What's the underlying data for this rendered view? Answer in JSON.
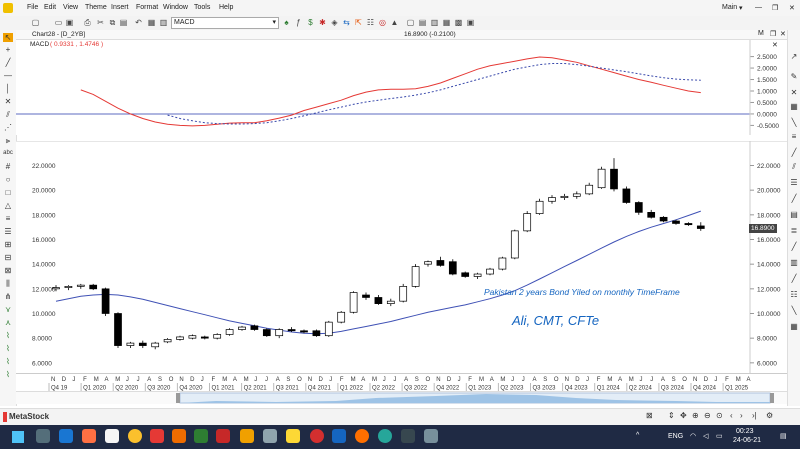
{
  "menubar": {
    "app_icon": "metastock-icon",
    "items": [
      "File",
      "Edit",
      "View",
      "Theme",
      "Insert",
      "Format",
      "Window",
      "Tools",
      "Help"
    ],
    "workspace": "Main",
    "window_controls": [
      "minimize",
      "restore",
      "close"
    ]
  },
  "toolbar": {
    "indicator_selector": "MACD"
  },
  "chart": {
    "tab": "Chart28 - [D_2YB]",
    "last_value": "16.8900 (-0.2100)",
    "price_badge": "16.8900",
    "macd_label": "MACD",
    "macd_values": "( 0.9331 ,  1.4746 )",
    "annotation_title": "Pakistan 2 years Bond Yiled on monthly TimeFrame",
    "annotation_author": "Ali, CMT, CFTe",
    "colors": {
      "macd_line": "#e53935",
      "signal_line": "#3949ab",
      "zero_line": "#5c6bc0",
      "ma_line": "#3f51b5",
      "annotation": "#1565c0"
    }
  },
  "chart_data": [
    {
      "type": "line",
      "title": "MACD",
      "y_ticks": [
        "2.5000",
        "2.0000",
        "1.5000",
        "1.0000",
        "0.5000",
        "0.0000",
        "-0.5000"
      ],
      "ylim": [
        -0.7,
        2.7
      ],
      "x_index": [
        0,
        1,
        2,
        3,
        4,
        5,
        6,
        7,
        8,
        9,
        10,
        11,
        12,
        13,
        14,
        15,
        16,
        17,
        18,
        19,
        20,
        21,
        22,
        23,
        24,
        25,
        26,
        27,
        28,
        29,
        30,
        31,
        32,
        33,
        34,
        35,
        36,
        37,
        38,
        39,
        40,
        41,
        42,
        43,
        44,
        45,
        46,
        47,
        48,
        49,
        50,
        51,
        52
      ],
      "series": [
        {
          "values": [
            null,
            null,
            1.05,
            0.85,
            0.55,
            0.25,
            0.0,
            -0.2,
            -0.35,
            -0.45,
            -0.5,
            -0.52,
            -0.5,
            -0.45,
            -0.4,
            -0.38,
            -0.38,
            -0.3,
            -0.18,
            -0.05,
            0.15,
            0.3,
            0.45,
            0.6,
            0.8,
            0.95,
            1.05,
            1.08,
            1.08,
            1.1,
            1.2,
            1.35,
            1.55,
            1.75,
            1.95,
            2.1,
            2.2,
            2.3,
            2.4,
            2.48,
            2.45,
            2.35,
            2.25,
            2.1,
            1.95,
            1.8,
            1.65,
            1.5,
            1.38,
            1.25,
            1.12,
            1.0,
            0.93
          ]
        },
        {
          "values": [
            null,
            null,
            null,
            null,
            null,
            null,
            null,
            null,
            null,
            -0.05,
            -0.2,
            -0.3,
            -0.38,
            -0.42,
            -0.44,
            -0.44,
            -0.42,
            -0.38,
            -0.3,
            -0.2,
            -0.08,
            0.05,
            0.18,
            0.3,
            0.42,
            0.52,
            0.6,
            0.67,
            0.74,
            0.82,
            0.92,
            1.05,
            1.2,
            1.35,
            1.5,
            1.65,
            1.8,
            1.95,
            2.05,
            2.15,
            2.2,
            2.2,
            2.15,
            2.08,
            2.0,
            1.92,
            1.84,
            1.75,
            1.66,
            1.58,
            1.52,
            1.49,
            1.47
          ]
        }
      ]
    },
    {
      "type": "candlestick",
      "y_ticks": [
        "22.0000",
        "20.0000",
        "18.0000",
        "16.0000",
        "14.0000",
        "12.0000",
        "10.0000",
        "8.0000",
        "6.0000"
      ],
      "ylim": [
        5.5,
        23.5
      ],
      "month_labels": [
        "N",
        "D",
        "J",
        "F",
        "M",
        "A",
        "M",
        "J",
        "J",
        "A",
        "S",
        "O",
        "N",
        "D",
        "J",
        "F",
        "M",
        "A",
        "M",
        "J",
        "J",
        "A",
        "S",
        "O",
        "N",
        "D",
        "J",
        "F",
        "M",
        "A",
        "M",
        "J",
        "J",
        "A",
        "S",
        "O",
        "N",
        "D",
        "J",
        "F",
        "M",
        "A",
        "M",
        "J",
        "J",
        "A",
        "S",
        "O",
        "N",
        "D",
        "J",
        "F",
        "M",
        "A",
        "M",
        "J",
        "J",
        "A",
        "S",
        "O",
        "N",
        "D",
        "J",
        "F",
        "M",
        "A"
      ],
      "quarter_labels": [
        "Q4 19",
        "Q1 2020",
        "Q2 2020",
        "Q3 2020",
        "Q4 2020",
        "Q1 2021",
        "Q2 2021",
        "Q3 2021",
        "Q4 2021",
        "Q1 2022",
        "Q2 2022",
        "Q3 2022",
        "Q4 2022",
        "Q1 2023",
        "Q2 2023",
        "Q3 2023",
        "Q4 2023",
        "Q1 2024",
        "Q2 2024",
        "Q3 2024",
        "Q4 2024",
        "Q1 2025"
      ],
      "candles": [
        {
          "o": 12.0,
          "h": 12.3,
          "l": 11.8,
          "c": 12.1
        },
        {
          "o": 12.1,
          "h": 12.3,
          "l": 11.9,
          "c": 12.2
        },
        {
          "o": 12.2,
          "h": 12.4,
          "l": 12.0,
          "c": 12.3
        },
        {
          "o": 12.3,
          "h": 12.4,
          "l": 11.9,
          "c": 12.0
        },
        {
          "o": 12.0,
          "h": 12.1,
          "l": 9.8,
          "c": 10.0
        },
        {
          "o": 10.0,
          "h": 10.1,
          "l": 7.2,
          "c": 7.4
        },
        {
          "o": 7.4,
          "h": 7.7,
          "l": 7.2,
          "c": 7.6
        },
        {
          "o": 7.6,
          "h": 7.8,
          "l": 7.2,
          "c": 7.4
        },
        {
          "o": 7.3,
          "h": 7.7,
          "l": 7.1,
          "c": 7.6
        },
        {
          "o": 7.7,
          "h": 8.0,
          "l": 7.6,
          "c": 7.9
        },
        {
          "o": 7.9,
          "h": 8.2,
          "l": 7.8,
          "c": 8.1
        },
        {
          "o": 8.0,
          "h": 8.3,
          "l": 7.9,
          "c": 8.2
        },
        {
          "o": 8.1,
          "h": 8.2,
          "l": 7.9,
          "c": 8.0
        },
        {
          "o": 8.0,
          "h": 8.4,
          "l": 7.9,
          "c": 8.3
        },
        {
          "o": 8.3,
          "h": 8.8,
          "l": 8.2,
          "c": 8.7
        },
        {
          "o": 8.7,
          "h": 9.0,
          "l": 8.6,
          "c": 8.9
        },
        {
          "o": 9.0,
          "h": 9.1,
          "l": 8.6,
          "c": 8.7
        },
        {
          "o": 8.7,
          "h": 8.8,
          "l": 8.1,
          "c": 8.2
        },
        {
          "o": 8.2,
          "h": 8.8,
          "l": 8.0,
          "c": 8.7
        },
        {
          "o": 8.7,
          "h": 8.9,
          "l": 8.5,
          "c": 8.6
        },
        {
          "o": 8.6,
          "h": 8.7,
          "l": 8.4,
          "c": 8.5
        },
        {
          "o": 8.6,
          "h": 8.7,
          "l": 8.1,
          "c": 8.2
        },
        {
          "o": 8.2,
          "h": 9.4,
          "l": 8.1,
          "c": 9.3
        },
        {
          "o": 9.3,
          "h": 10.2,
          "l": 9.2,
          "c": 10.1
        },
        {
          "o": 10.1,
          "h": 11.8,
          "l": 10.0,
          "c": 11.7
        },
        {
          "o": 11.5,
          "h": 11.7,
          "l": 11.1,
          "c": 11.3
        },
        {
          "o": 11.3,
          "h": 11.5,
          "l": 10.7,
          "c": 10.8
        },
        {
          "o": 10.8,
          "h": 11.2,
          "l": 10.6,
          "c": 11.0
        },
        {
          "o": 11.0,
          "h": 12.4,
          "l": 10.9,
          "c": 12.2
        },
        {
          "o": 12.2,
          "h": 14.0,
          "l": 12.1,
          "c": 13.8
        },
        {
          "o": 14.0,
          "h": 14.3,
          "l": 13.8,
          "c": 14.2
        },
        {
          "o": 14.3,
          "h": 14.6,
          "l": 13.8,
          "c": 13.9
        },
        {
          "o": 14.2,
          "h": 14.4,
          "l": 13.1,
          "c": 13.2
        },
        {
          "o": 13.3,
          "h": 13.4,
          "l": 12.9,
          "c": 13.0
        },
        {
          "o": 13.0,
          "h": 13.3,
          "l": 12.8,
          "c": 13.2
        },
        {
          "o": 13.2,
          "h": 13.7,
          "l": 13.1,
          "c": 13.6
        },
        {
          "o": 13.6,
          "h": 14.6,
          "l": 13.5,
          "c": 14.5
        },
        {
          "o": 14.5,
          "h": 16.8,
          "l": 14.4,
          "c": 16.7
        },
        {
          "o": 16.7,
          "h": 18.3,
          "l": 16.6,
          "c": 18.1
        },
        {
          "o": 18.1,
          "h": 19.3,
          "l": 18.0,
          "c": 19.1
        },
        {
          "o": 19.1,
          "h": 19.6,
          "l": 18.9,
          "c": 19.4
        },
        {
          "o": 19.4,
          "h": 19.7,
          "l": 19.2,
          "c": 19.5
        },
        {
          "o": 19.5,
          "h": 19.9,
          "l": 19.3,
          "c": 19.7
        },
        {
          "o": 19.7,
          "h": 20.6,
          "l": 19.6,
          "c": 20.4
        },
        {
          "o": 20.2,
          "h": 21.9,
          "l": 20.1,
          "c": 21.7
        },
        {
          "o": 21.7,
          "h": 22.6,
          "l": 19.9,
          "c": 20.1
        },
        {
          "o": 20.1,
          "h": 20.3,
          "l": 18.9,
          "c": 19.0
        },
        {
          "o": 19.0,
          "h": 19.1,
          "l": 18.0,
          "c": 18.2
        },
        {
          "o": 18.2,
          "h": 18.4,
          "l": 17.7,
          "c": 17.8
        },
        {
          "o": 17.8,
          "h": 17.9,
          "l": 17.4,
          "c": 17.5
        },
        {
          "o": 17.5,
          "h": 17.6,
          "l": 17.2,
          "c": 17.3
        },
        {
          "o": 17.3,
          "h": 17.4,
          "l": 17.1,
          "c": 17.2
        },
        {
          "o": 17.1,
          "h": 17.4,
          "l": 16.7,
          "c": 16.89
        }
      ],
      "ma": [
        11.0,
        11.2,
        11.4,
        11.5,
        11.55,
        11.5,
        11.35,
        11.15,
        10.9,
        10.65,
        10.4,
        10.15,
        9.9,
        9.65,
        9.4,
        9.2,
        9.0,
        8.8,
        8.65,
        8.5,
        8.4,
        8.35,
        8.4,
        8.55,
        8.75,
        8.95,
        9.15,
        9.35,
        9.6,
        9.85,
        10.1,
        10.3,
        10.5,
        10.7,
        10.95,
        11.2,
        11.5,
        11.85,
        12.3,
        12.8,
        13.3,
        13.8,
        14.3,
        14.8,
        15.3,
        15.8,
        16.25,
        16.65,
        17.0,
        17.3,
        17.6,
        17.95,
        18.3
      ]
    }
  ],
  "statusbar": {
    "brand": "MetaStock"
  },
  "taskbar": {
    "language": "ENG",
    "time": "00:23",
    "date": "24-06-21"
  }
}
